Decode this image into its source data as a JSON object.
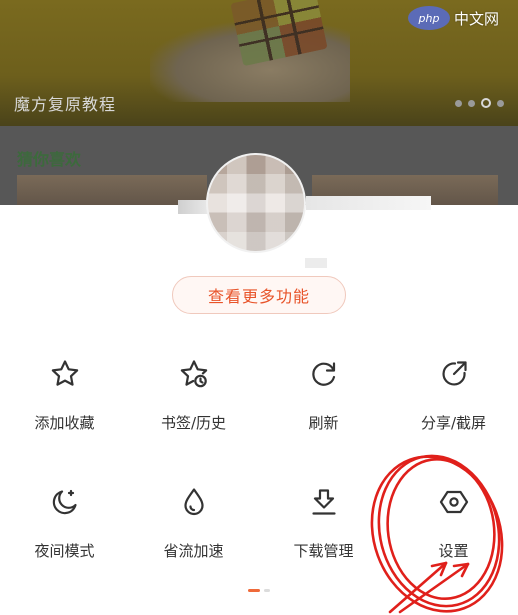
{
  "watermark": {
    "logo": "php",
    "text": "中文网"
  },
  "background": {
    "banner_title": "魔方复原教程",
    "section_title": "猜你喜欢"
  },
  "sheet": {
    "more_button": "查看更多功能",
    "items": [
      {
        "label": "添加收藏",
        "icon": "star-icon"
      },
      {
        "label": "书签/历史",
        "icon": "star-clock-icon"
      },
      {
        "label": "刷新",
        "icon": "refresh-icon"
      },
      {
        "label": "分享/截屏",
        "icon": "share-icon"
      },
      {
        "label": "夜间模式",
        "icon": "moon-icon"
      },
      {
        "label": "省流加速",
        "icon": "drop-icon"
      },
      {
        "label": "下载管理",
        "icon": "download-icon"
      },
      {
        "label": "设置",
        "icon": "settings-hexagon-icon"
      }
    ],
    "page_indicator": {
      "pages": 2,
      "current": 1
    }
  },
  "colors": {
    "accent": "#e8542a",
    "annotation": "#e0201b"
  }
}
